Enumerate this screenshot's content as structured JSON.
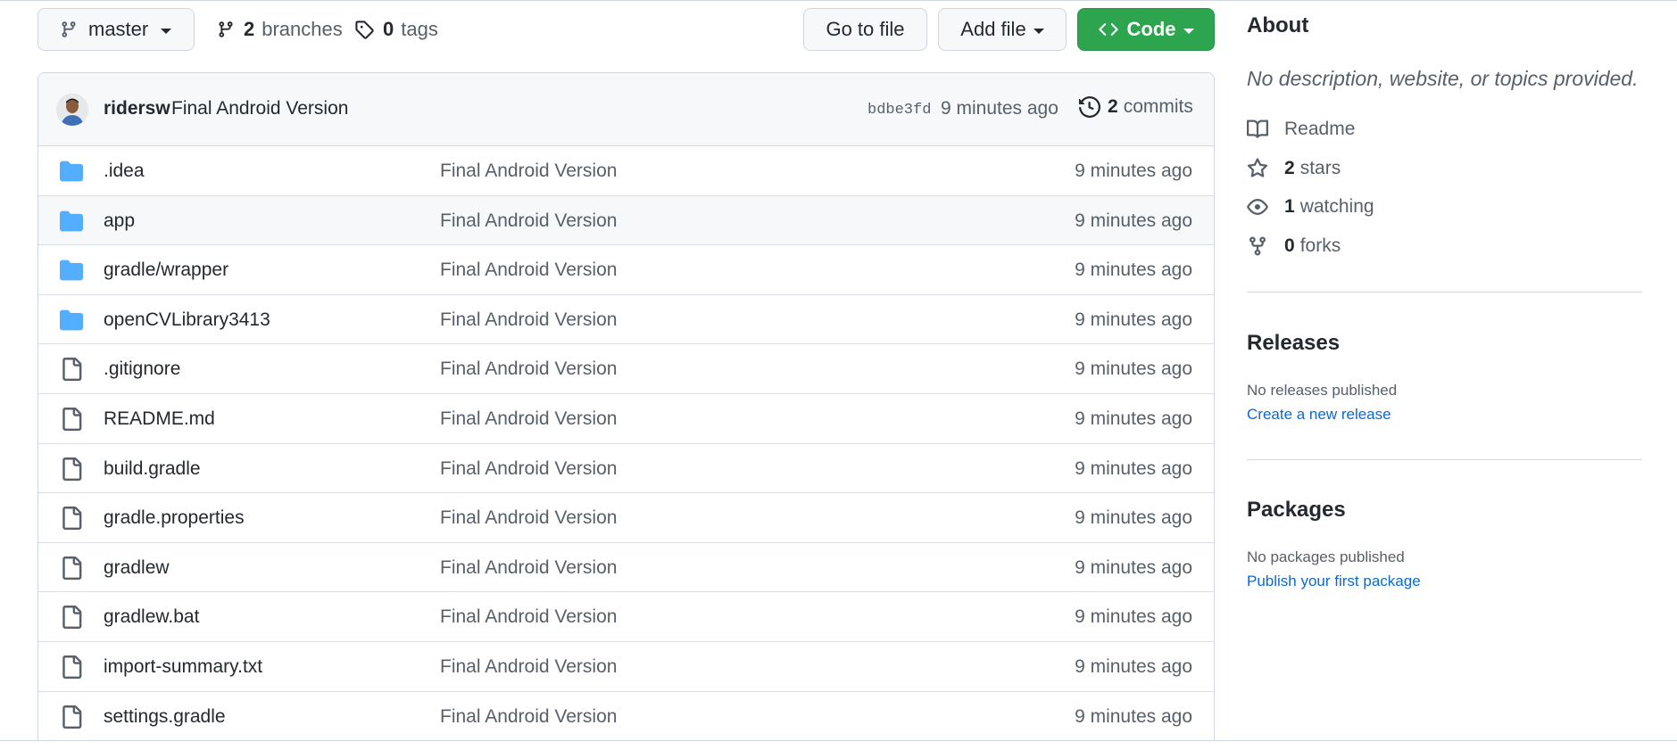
{
  "toolbar": {
    "branch": "master",
    "branches_count": "2",
    "branches_label": "branches",
    "tags_count": "0",
    "tags_label": "tags",
    "go_to_file": "Go to file",
    "add_file": "Add file",
    "code": "Code"
  },
  "commit": {
    "author": "ridersw",
    "message": "Final Android Version",
    "sha": "bdbe3fd",
    "time": "9 minutes ago",
    "count": "2",
    "count_label": "commits"
  },
  "files": [
    {
      "name": ".idea",
      "type": "folder",
      "message": "Final Android Version",
      "time": "9 minutes ago"
    },
    {
      "name": "app",
      "type": "folder",
      "message": "Final Android Version",
      "time": "9 minutes ago"
    },
    {
      "name": "gradle/wrapper",
      "type": "folder",
      "message": "Final Android Version",
      "time": "9 minutes ago"
    },
    {
      "name": "openCVLibrary3413",
      "type": "folder",
      "message": "Final Android Version",
      "time": "9 minutes ago"
    },
    {
      "name": ".gitignore",
      "type": "file",
      "message": "Final Android Version",
      "time": "9 minutes ago"
    },
    {
      "name": "README.md",
      "type": "file",
      "message": "Final Android Version",
      "time": "9 minutes ago"
    },
    {
      "name": "build.gradle",
      "type": "file",
      "message": "Final Android Version",
      "time": "9 minutes ago"
    },
    {
      "name": "gradle.properties",
      "type": "file",
      "message": "Final Android Version",
      "time": "9 minutes ago"
    },
    {
      "name": "gradlew",
      "type": "file",
      "message": "Final Android Version",
      "time": "9 minutes ago"
    },
    {
      "name": "gradlew.bat",
      "type": "file",
      "message": "Final Android Version",
      "time": "9 minutes ago"
    },
    {
      "name": "import-summary.txt",
      "type": "file",
      "message": "Final Android Version",
      "time": "9 minutes ago"
    },
    {
      "name": "settings.gradle",
      "type": "file",
      "message": "Final Android Version",
      "time": "9 minutes ago"
    }
  ],
  "about": {
    "title": "About",
    "description": "No description, website, or topics provided.",
    "readme": "Readme",
    "stars_count": "2",
    "stars_label": "stars",
    "watching_count": "1",
    "watching_label": "watching",
    "forks_count": "0",
    "forks_label": "forks"
  },
  "releases": {
    "title": "Releases",
    "note": "No releases published",
    "link": "Create a new release"
  },
  "packages": {
    "title": "Packages",
    "note": "No packages published",
    "link": "Publish your first package"
  },
  "colors": {
    "accent_green": "#2da44e",
    "link_blue": "#0969da",
    "folder_blue": "#54aeff"
  }
}
